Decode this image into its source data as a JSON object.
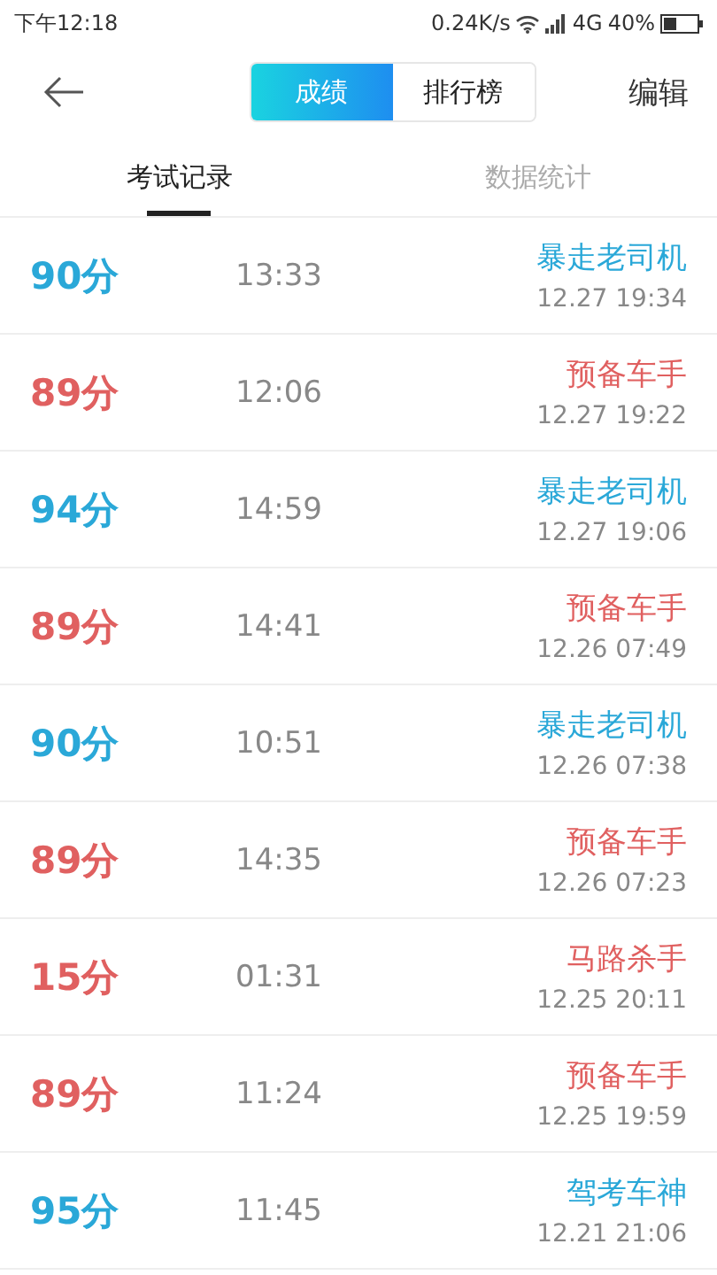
{
  "status_bar": {
    "time": "下午12:18",
    "speed": "0.24K/s",
    "network": "4G",
    "battery": "40%"
  },
  "nav": {
    "segments": [
      {
        "label": "成绩",
        "selected": true
      },
      {
        "label": "排行榜",
        "selected": false
      }
    ],
    "action": "编辑"
  },
  "tabs": [
    {
      "label": "考试记录",
      "selected": true
    },
    {
      "label": "数据统计",
      "selected": false
    }
  ],
  "records": [
    {
      "score": "90分",
      "duration": "13:33",
      "title": "暴走老司机",
      "date": "12.27  19:34",
      "color": "#2aa8d8"
    },
    {
      "score": "89分",
      "duration": "12:06",
      "title": "预备车手",
      "date": "12.27  19:22",
      "color": "#e06060"
    },
    {
      "score": "94分",
      "duration": "14:59",
      "title": "暴走老司机",
      "date": "12.27  19:06",
      "color": "#2aa8d8"
    },
    {
      "score": "89分",
      "duration": "14:41",
      "title": "预备车手",
      "date": "12.26  07:49",
      "color": "#e06060"
    },
    {
      "score": "90分",
      "duration": "10:51",
      "title": "暴走老司机",
      "date": "12.26  07:38",
      "color": "#2aa8d8"
    },
    {
      "score": "89分",
      "duration": "14:35",
      "title": "预备车手",
      "date": "12.26  07:23",
      "color": "#e06060"
    },
    {
      "score": "15分",
      "duration": "01:31",
      "title": "马路杀手",
      "date": "12.25  20:11",
      "color": "#e06060"
    },
    {
      "score": "89分",
      "duration": "11:24",
      "title": "预备车手",
      "date": "12.25  19:59",
      "color": "#e06060"
    },
    {
      "score": "95分",
      "duration": "11:45",
      "title": "驾考车神",
      "date": "12.21  21:06",
      "color": "#2aa8d8"
    }
  ]
}
